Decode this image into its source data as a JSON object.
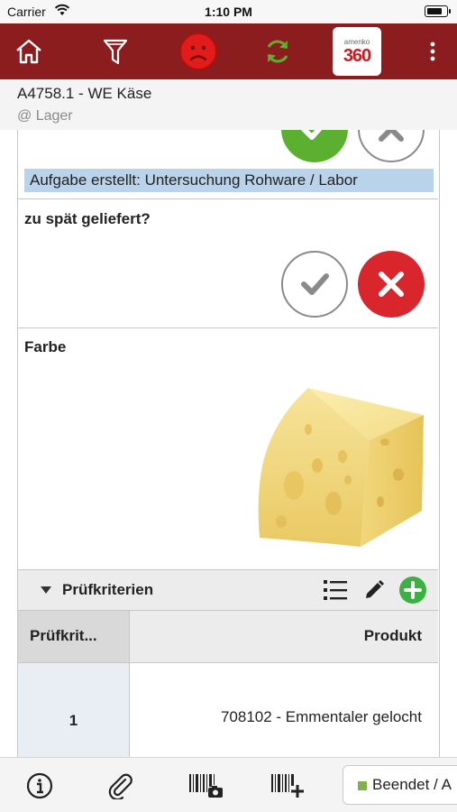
{
  "status_bar": {
    "carrier": "Carrier",
    "time": "1:10 PM",
    "battery_level": 0.85
  },
  "toolbar": {
    "icons": [
      "home-icon",
      "filter-icon",
      "sad-face-icon",
      "sync-icon",
      "amenko-360-logo",
      "more-vertical-icon"
    ],
    "logo_top": "amenko",
    "logo_main": "360",
    "colors": {
      "bar": "#8b1d1e",
      "sad": "#e21b1b",
      "sync": "#5cb030"
    }
  },
  "header": {
    "title": "A4758.1 - WE Käse",
    "location": "@ Lager"
  },
  "sections": [
    {
      "task_text": "Aufgabe erstellt: Untersuchung Rohware / Labor"
    },
    {
      "question": "zu spät geliefert?"
    },
    {
      "label": "Farbe",
      "image": "cheese-image"
    }
  ],
  "subgrid": {
    "title": "Prüfkriterien",
    "columns": [
      "Prüfkrit...",
      "Produkt"
    ],
    "rows": [
      {
        "nr": "1",
        "product": "708102 - Emmentaler gelocht"
      }
    ]
  },
  "bottom_bar": {
    "icons": [
      "info-icon",
      "paperclip-icon",
      "barcode-camera-icon",
      "barcode-add-icon"
    ],
    "status_label": "Beendet / A",
    "status_color": "#7fb24a"
  }
}
